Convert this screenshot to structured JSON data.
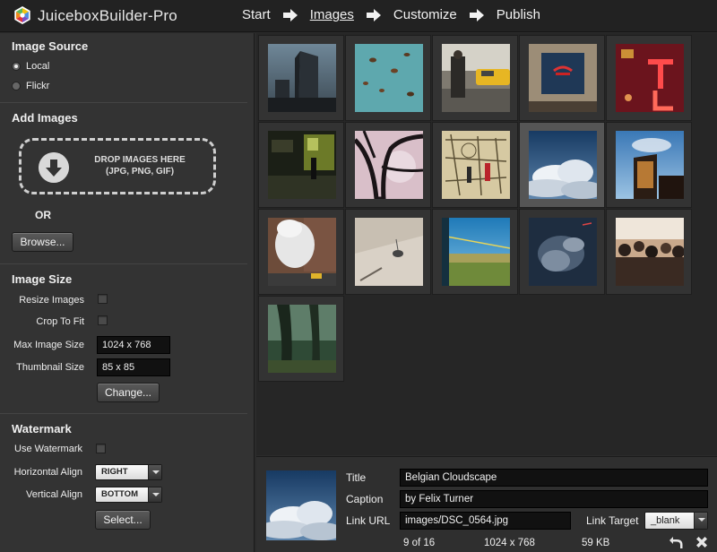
{
  "app": {
    "title": "JuiceboxBuilder-Pro",
    "steps": [
      "Start",
      "Images",
      "Customize",
      "Publish"
    ],
    "active_step": "Images"
  },
  "image_source": {
    "title": "Image Source",
    "options": [
      "Local",
      "Flickr"
    ],
    "selected": "Local"
  },
  "add_images": {
    "title": "Add Images",
    "drop_text_line1": "DROP IMAGES HERE",
    "drop_text_line2": "(JPG, PNG, GIF)",
    "or_label": "OR",
    "browse_label": "Browse..."
  },
  "image_size": {
    "title": "Image Size",
    "resize_label": "Resize Images",
    "resize_checked": false,
    "crop_label": "Crop To Fit",
    "crop_checked": false,
    "max_size_label": "Max Image Size",
    "max_size_value": "1024 x 768",
    "thumb_size_label": "Thumbnail Size",
    "thumb_size_value": "85 x 85",
    "change_label": "Change..."
  },
  "watermark": {
    "title": "Watermark",
    "use_label": "Use Watermark",
    "use_checked": false,
    "h_align_label": "Horizontal Align",
    "h_align_value": "RIGHT",
    "v_align_label": "Vertical Align",
    "v_align_value": "BOTTOM",
    "select_label": "Select..."
  },
  "gallery": {
    "selected_index": 9,
    "thumbnail_icons": [
      "skyscraper-thumb",
      "leaves-thumb",
      "taxi-street-thumb",
      "gallery-wall-thumb",
      "neon-sign-thumb",
      "night-street-thumb",
      "tree-silhouette-thumb",
      "drawn-room-thumb",
      "cloudscape-thumb",
      "building-sunset-thumb",
      "steam-street-thumb",
      "ceiling-lamp-thumb",
      "train-window-thumb",
      "storm-cloud-thumb",
      "crowd-thumb",
      "forest-thumb"
    ]
  },
  "details": {
    "title_label": "Title",
    "title_value": "Belgian Cloudscape",
    "caption_label": "Caption",
    "caption_value": "by Felix Turner",
    "link_url_label": "Link URL",
    "link_url_value": "images/DSC_0564.jpg",
    "link_target_label": "Link Target",
    "link_target_value": "_blank",
    "position": "9 of 16",
    "dimensions": "1024 x 768",
    "filesize": "59 KB"
  }
}
